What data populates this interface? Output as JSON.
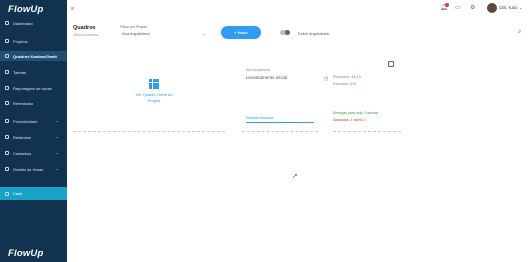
{
  "app": {
    "logo": "FlowUp",
    "user_name": "Olá, Kaio"
  },
  "sidebar": {
    "items": [
      {
        "label": "Dashboard",
        "has_chevron": false
      },
      {
        "label": "Projetos",
        "has_chevron": false
      },
      {
        "label": "Quadros Kanban/Gantt",
        "has_chevron": false,
        "active": true
      },
      {
        "label": "Tarefas",
        "has_chevron": false
      },
      {
        "label": "Reportagem de horas",
        "has_chevron": false
      },
      {
        "label": "Reembolso",
        "has_chevron": false
      },
      {
        "label": "Produtividade",
        "has_chevron": true
      },
      {
        "label": "Relatórios",
        "has_chevron": true
      },
      {
        "label": "Cadastros",
        "has_chevron": true
      },
      {
        "label": "Gestão de Horas",
        "has_chevron": true
      },
      {
        "label": "Cash",
        "has_chevron": false
      }
    ]
  },
  "header": {
    "title": "Quadros",
    "subtitle": "Últimos Acessos",
    "filter_label": "Filtrar por Projeto",
    "filter_value": "Ária Arquitetura",
    "new_button": "+ Novo",
    "toggle_label": "Exibir Arquivados"
  },
  "cards": {
    "general_view": "Ver Quadro Geral do Projeto",
    "board_tag": "Ária Arquitetura",
    "board_title": "Levantamento inicial",
    "estimated_label": "Reportado:",
    "estimated_value": "94,2 h",
    "done_label": "Estimado:",
    "done_value": "10 h",
    "progress_label": "Entrada realizada",
    "progress_fraction": 1.0,
    "delivery_link": "Entregas para hoje: 3 tarefas",
    "overdue_link": "Atrasadas: 1 tarefa"
  },
  "colors": {
    "sidebar_bg": "#11334f",
    "accent": "#2e9cf2",
    "cash": "#19a3c6",
    "ok": "#3a9a3a",
    "danger": "#e53935"
  }
}
